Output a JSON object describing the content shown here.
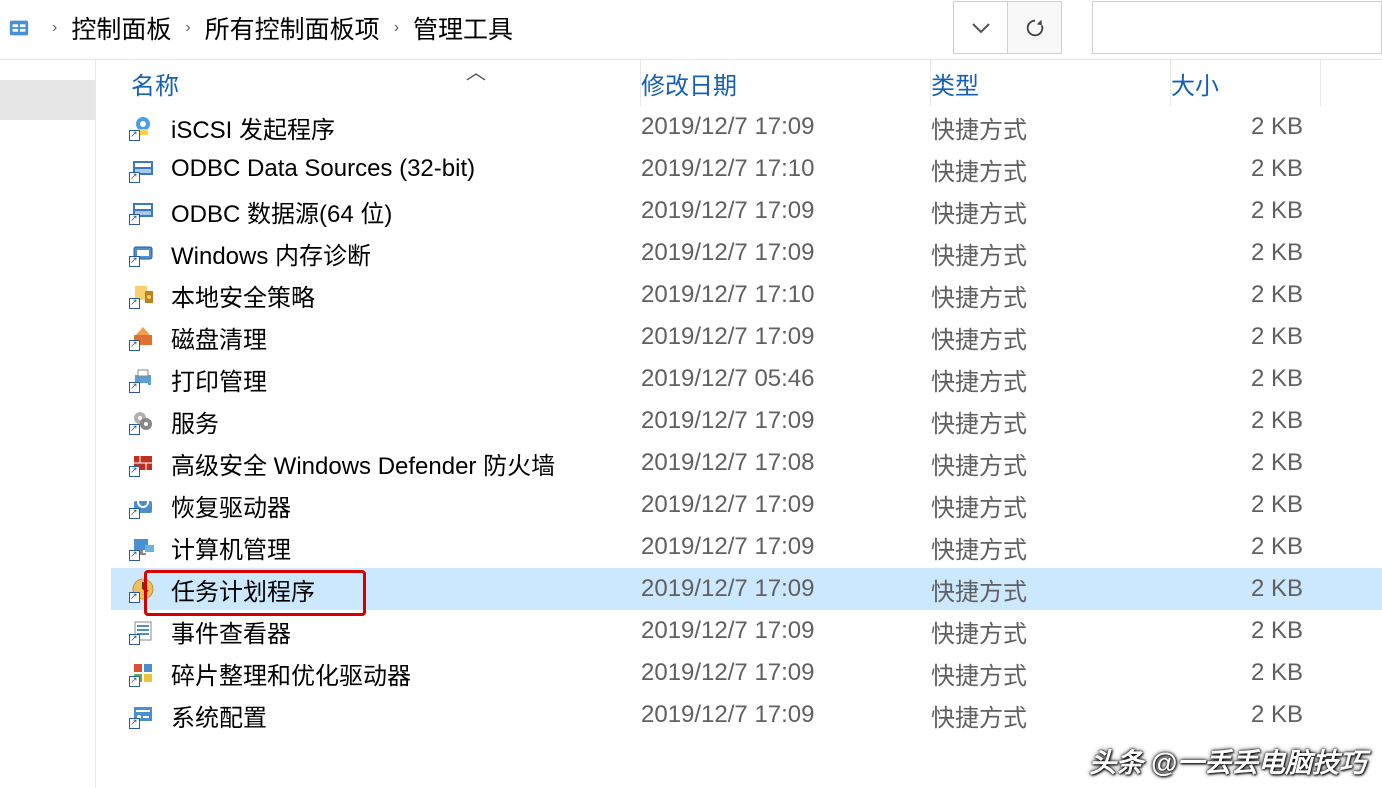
{
  "breadcrumb": {
    "items": [
      "控制面板",
      "所有控制面板项",
      "管理工具"
    ]
  },
  "columns": {
    "name": "名称",
    "date": "修改日期",
    "type": "类型",
    "size": "大小"
  },
  "files": [
    {
      "icon": "iscsi",
      "name": "iSCSI 发起程序",
      "date": "2019/12/7 17:09",
      "type": "快捷方式",
      "size": "2 KB",
      "selected": false
    },
    {
      "icon": "odbc",
      "name": "ODBC Data Sources (32-bit)",
      "date": "2019/12/7 17:10",
      "type": "快捷方式",
      "size": "2 KB",
      "selected": false
    },
    {
      "icon": "odbc",
      "name": "ODBC 数据源(64 位)",
      "date": "2019/12/7 17:09",
      "type": "快捷方式",
      "size": "2 KB",
      "selected": false
    },
    {
      "icon": "memdiag",
      "name": "Windows 内存诊断",
      "date": "2019/12/7 17:09",
      "type": "快捷方式",
      "size": "2 KB",
      "selected": false
    },
    {
      "icon": "secpol",
      "name": "本地安全策略",
      "date": "2019/12/7 17:10",
      "type": "快捷方式",
      "size": "2 KB",
      "selected": false
    },
    {
      "icon": "diskclean",
      "name": "磁盘清理",
      "date": "2019/12/7 17:09",
      "type": "快捷方式",
      "size": "2 KB",
      "selected": false
    },
    {
      "icon": "print",
      "name": "打印管理",
      "date": "2019/12/7 05:46",
      "type": "快捷方式",
      "size": "2 KB",
      "selected": false
    },
    {
      "icon": "services",
      "name": "服务",
      "date": "2019/12/7 17:09",
      "type": "快捷方式",
      "size": "2 KB",
      "selected": false
    },
    {
      "icon": "firewall",
      "name": "高级安全 Windows Defender 防火墙",
      "date": "2019/12/7 17:08",
      "type": "快捷方式",
      "size": "2 KB",
      "selected": false
    },
    {
      "icon": "recovery",
      "name": "恢复驱动器",
      "date": "2019/12/7 17:09",
      "type": "快捷方式",
      "size": "2 KB",
      "selected": false
    },
    {
      "icon": "compmgmt",
      "name": "计算机管理",
      "date": "2019/12/7 17:09",
      "type": "快捷方式",
      "size": "2 KB",
      "selected": false
    },
    {
      "icon": "tasksched",
      "name": "任务计划程序",
      "date": "2019/12/7 17:09",
      "type": "快捷方式",
      "size": "2 KB",
      "selected": true
    },
    {
      "icon": "eventvwr",
      "name": "事件查看器",
      "date": "2019/12/7 17:09",
      "type": "快捷方式",
      "size": "2 KB",
      "selected": false
    },
    {
      "icon": "defrag",
      "name": "碎片整理和优化驱动器",
      "date": "2019/12/7 17:09",
      "type": "快捷方式",
      "size": "2 KB",
      "selected": false
    },
    {
      "icon": "msconfig",
      "name": "系统配置",
      "date": "2019/12/7 17:09",
      "type": "快捷方式",
      "size": "2 KB",
      "selected": false
    }
  ],
  "highlightIndex": 11,
  "watermark": "头条 @一丢丢电脑技巧"
}
